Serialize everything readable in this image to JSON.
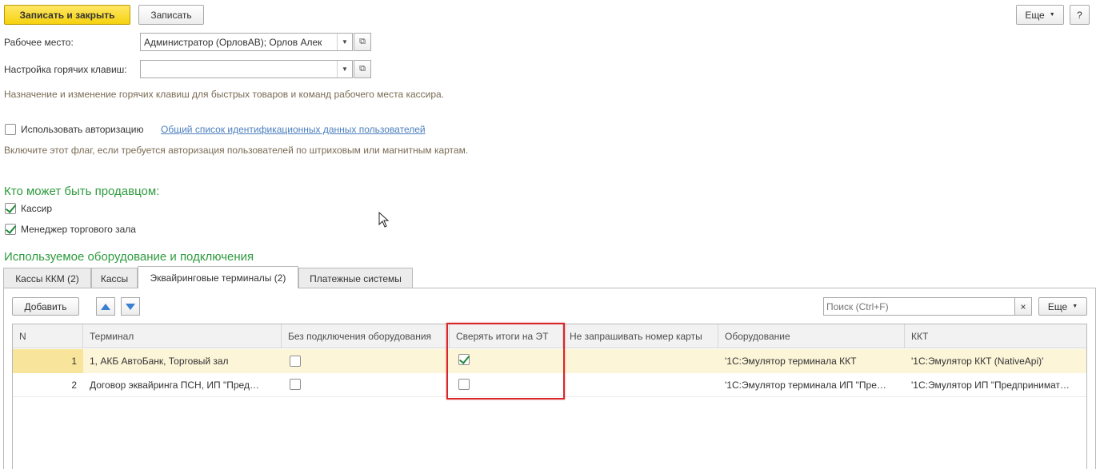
{
  "toolbar": {
    "save_close_label": "Записать и закрыть",
    "save_label": "Записать",
    "more_label": "Еще",
    "help_label": "?"
  },
  "form": {
    "workplace_label": "Рабочее место:",
    "workplace_value": "Администратор (ОрловАВ); Орлов Алек",
    "hotkeys_label": "Настройка горячих клавиш:",
    "hotkeys_value": "",
    "hotkeys_hint": "Назначение и изменение горячих клавиш для быстрых товаров и команд рабочего места кассира.",
    "auth_label": "Использовать авторизацию",
    "auth_checked": false,
    "auth_link": "Общий список идентификационных данных пользователей",
    "auth_hint": "Включите этот флаг, если требуется авторизация пользователей по штриховым или магнитным картам."
  },
  "sellers": {
    "title": "Кто может быть продавцом:",
    "cashier_label": "Кассир",
    "cashier_checked": true,
    "manager_label": "Менеджер торгового зала",
    "manager_checked": true
  },
  "equipment": {
    "title": "Используемое оборудование и подключения",
    "tabs": [
      {
        "label": "Кассы ККМ (2)",
        "active": false
      },
      {
        "label": "Кассы",
        "active": false
      },
      {
        "label": "Эквайринговые терминалы (2)",
        "active": true
      },
      {
        "label": "Платежные системы",
        "active": false
      }
    ],
    "add_label": "Добавить",
    "search_placeholder": "Поиск (Ctrl+F)",
    "search_clear": "×",
    "more_label": "Еще",
    "columns": [
      "N",
      "Терминал",
      "Без подключения оборудования",
      "Сверять итоги на ЭТ",
      "Не запрашивать номер карты",
      "Оборудование",
      "ККТ"
    ],
    "rows": [
      {
        "n": "1",
        "terminal": "1, АКБ АвтоБанк, Торговый зал",
        "no_equipment": false,
        "reconcile": true,
        "equipment": "'1С:Эмулятор терминала ККТ",
        "kkt": "'1С:Эмулятор ККТ (NativeApi)'"
      },
      {
        "n": "2",
        "terminal": "Договор эквайринга ПСН, ИП \"Пред…",
        "no_equipment": false,
        "reconcile": false,
        "equipment": "'1С:Эмулятор терминала ИП \"Пре…",
        "kkt": "'1С:Эмулятор ИП \"Предпринимат…"
      }
    ]
  },
  "colors": {
    "primary_button": "#f5d20f",
    "section_title": "#2e9b3e",
    "link": "#4c7fbf",
    "selected_row": "#fcf5d8",
    "highlight_box": "#d9262b"
  }
}
